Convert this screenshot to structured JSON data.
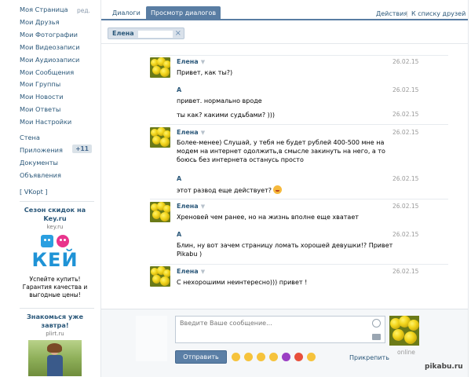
{
  "sidebar": {
    "edit_label": "ред.",
    "items": [
      {
        "label": "Моя Страница"
      },
      {
        "label": "Мои Друзья"
      },
      {
        "label": "Мои Фотографии"
      },
      {
        "label": "Мои Видеозаписи"
      },
      {
        "label": "Мои Аудиозаписи"
      },
      {
        "label": "Мои Сообщения"
      },
      {
        "label": "Мои Группы"
      },
      {
        "label": "Мои Новости"
      },
      {
        "label": "Мои Ответы"
      },
      {
        "label": "Мои Настройки"
      }
    ],
    "items2": [
      {
        "label": "Стена"
      },
      {
        "label": "Приложения",
        "badge": "+11"
      },
      {
        "label": "Документы"
      },
      {
        "label": "Объявления"
      }
    ],
    "vkopt": "[ VKopt ]",
    "ad1": {
      "title": "Сезон скидок на Key.ru",
      "domain": "key.ru",
      "logo_text": "КЕЙ",
      "text": "Успейте купить! Гарантия качества и выгодные цены!"
    },
    "ad2": {
      "title": "Знакомься уже завтра!",
      "domain": "plirt.ru"
    }
  },
  "tabs": {
    "dialogs": "Диалоги",
    "view": "Просмотр диалогов",
    "actions": "Действия",
    "divider": "|",
    "to_friends": "К списку друзей"
  },
  "filter": {
    "name": "Елена",
    "close": "×"
  },
  "messages": [
    {
      "author": "Елена",
      "date": "26.02.15",
      "lines": [
        "Привет, как ты?)"
      ]
    },
    {
      "author": "А",
      "date": "26.02.15",
      "lines": [
        "привет. нормально вроде"
      ]
    },
    {
      "author": "",
      "date": "26.02.15",
      "lines": [
        "ты как? какими судьбами? )))"
      ]
    },
    {
      "author": "Елена",
      "date": "26.02.15",
      "lines": [
        "Более-менее) Слушай, у тебя не будет рублей 400-500 мне на",
        "модем на интернет одолжить,в смысле закинуть на него, а то",
        "боюсь без интернета останусь просто"
      ]
    },
    {
      "author": "А",
      "date": "26.02.15",
      "lines": [
        "этот развод еще действует?"
      ]
    },
    {
      "author": "Елена",
      "date": "26.02.15",
      "lines": [
        "Хреновей чем ранее, но на жизнь вполне еще хватает"
      ]
    },
    {
      "author": "А",
      "date": "26.02.15",
      "lines": [
        "Блин, ну вот зачем страницу ломать хорошей девушки!? Привет",
        "Pikabu )"
      ]
    },
    {
      "author": "Елена",
      "date": "26.02.15",
      "lines": [
        "С нехорошими неинтересно))) привет !"
      ]
    }
  ],
  "compose": {
    "placeholder": "Введите Ваше сообщение...",
    "send": "Отправить",
    "attach": "Прикрепить",
    "online": "online"
  },
  "watermark": "pikabu.ru",
  "colors": {
    "link": "#2b587a",
    "tab_active": "#597da3",
    "button": "#5b7fa6"
  }
}
